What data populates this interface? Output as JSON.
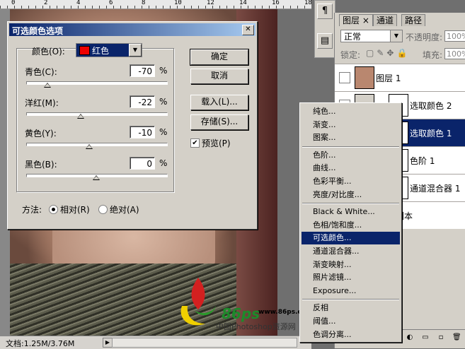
{
  "ruler": {
    "labels": [
      "0",
      "2",
      "4",
      "6",
      "8",
      "10",
      "12",
      "14",
      "16",
      "18"
    ]
  },
  "status": {
    "doc_info": "文档:1.25M/3.76M",
    "arrow": "▶"
  },
  "watermark": {
    "brand": "86ps",
    "url": "www.86ps.com",
    "site_name": "中国Photoshop资源网"
  },
  "dialog": {
    "title": "可选颜色选项",
    "close_glyph": "✕",
    "color_label": "颜色(O):",
    "color_value": "红色",
    "sliders": [
      {
        "label": "青色(C):",
        "value": "-70",
        "unit": "%",
        "level": -70
      },
      {
        "label": "洋红(M):",
        "value": "-22",
        "unit": "%",
        "level": -22
      },
      {
        "label": "黄色(Y):",
        "value": "-10",
        "unit": "%",
        "level": -10
      },
      {
        "label": "黑色(B):",
        "value": "0",
        "unit": "%",
        "level": 0
      }
    ],
    "buttons": {
      "ok": "确定",
      "cancel": "取消",
      "load": "载入(L)...",
      "save": "存储(S)..."
    },
    "preview_label": "预览(P)",
    "preview_checked": true,
    "method_label": "方法:",
    "method_options": [
      "相对(R)",
      "绝对(A)"
    ],
    "method_selected": "相对(R)"
  },
  "layers_panel": {
    "tabs": [
      "图层",
      "通道",
      "路径"
    ],
    "tab_close": "×",
    "blend_mode": "正常",
    "opacity_label": "不透明度:",
    "opacity_value": "100%",
    "lock_label": "锁定:",
    "fill_label": "填充:",
    "fill_value": "100%",
    "layers": [
      {
        "name": "图层 1",
        "selected": false
      },
      {
        "name": "选取颜色 2",
        "selected": false
      },
      {
        "name": "选取颜色 1",
        "selected": true
      },
      {
        "name": "色阶 1",
        "selected": false
      },
      {
        "name": "通道混合器 1",
        "selected": false
      },
      {
        "name": "副本",
        "selected": false
      }
    ]
  },
  "context_menu": {
    "groups": [
      [
        "纯色...",
        "渐变...",
        "图案..."
      ],
      [
        "色阶...",
        "曲线...",
        "色彩平衡...",
        "亮度/对比度..."
      ],
      [
        "Black & White...",
        "色相/饱和度...",
        "可选颜色...",
        "通道混合器...",
        "渐变映射...",
        "照片滤镜...",
        "Exposure..."
      ],
      [
        "反相",
        "阈值...",
        "色调分离..."
      ]
    ],
    "highlighted": "可选颜色..."
  },
  "colors": {
    "title_bar": "#0a246a",
    "selection": "#0a246a",
    "swatch_red": "#e00000",
    "dialog_bg": "#d4d0c8"
  }
}
